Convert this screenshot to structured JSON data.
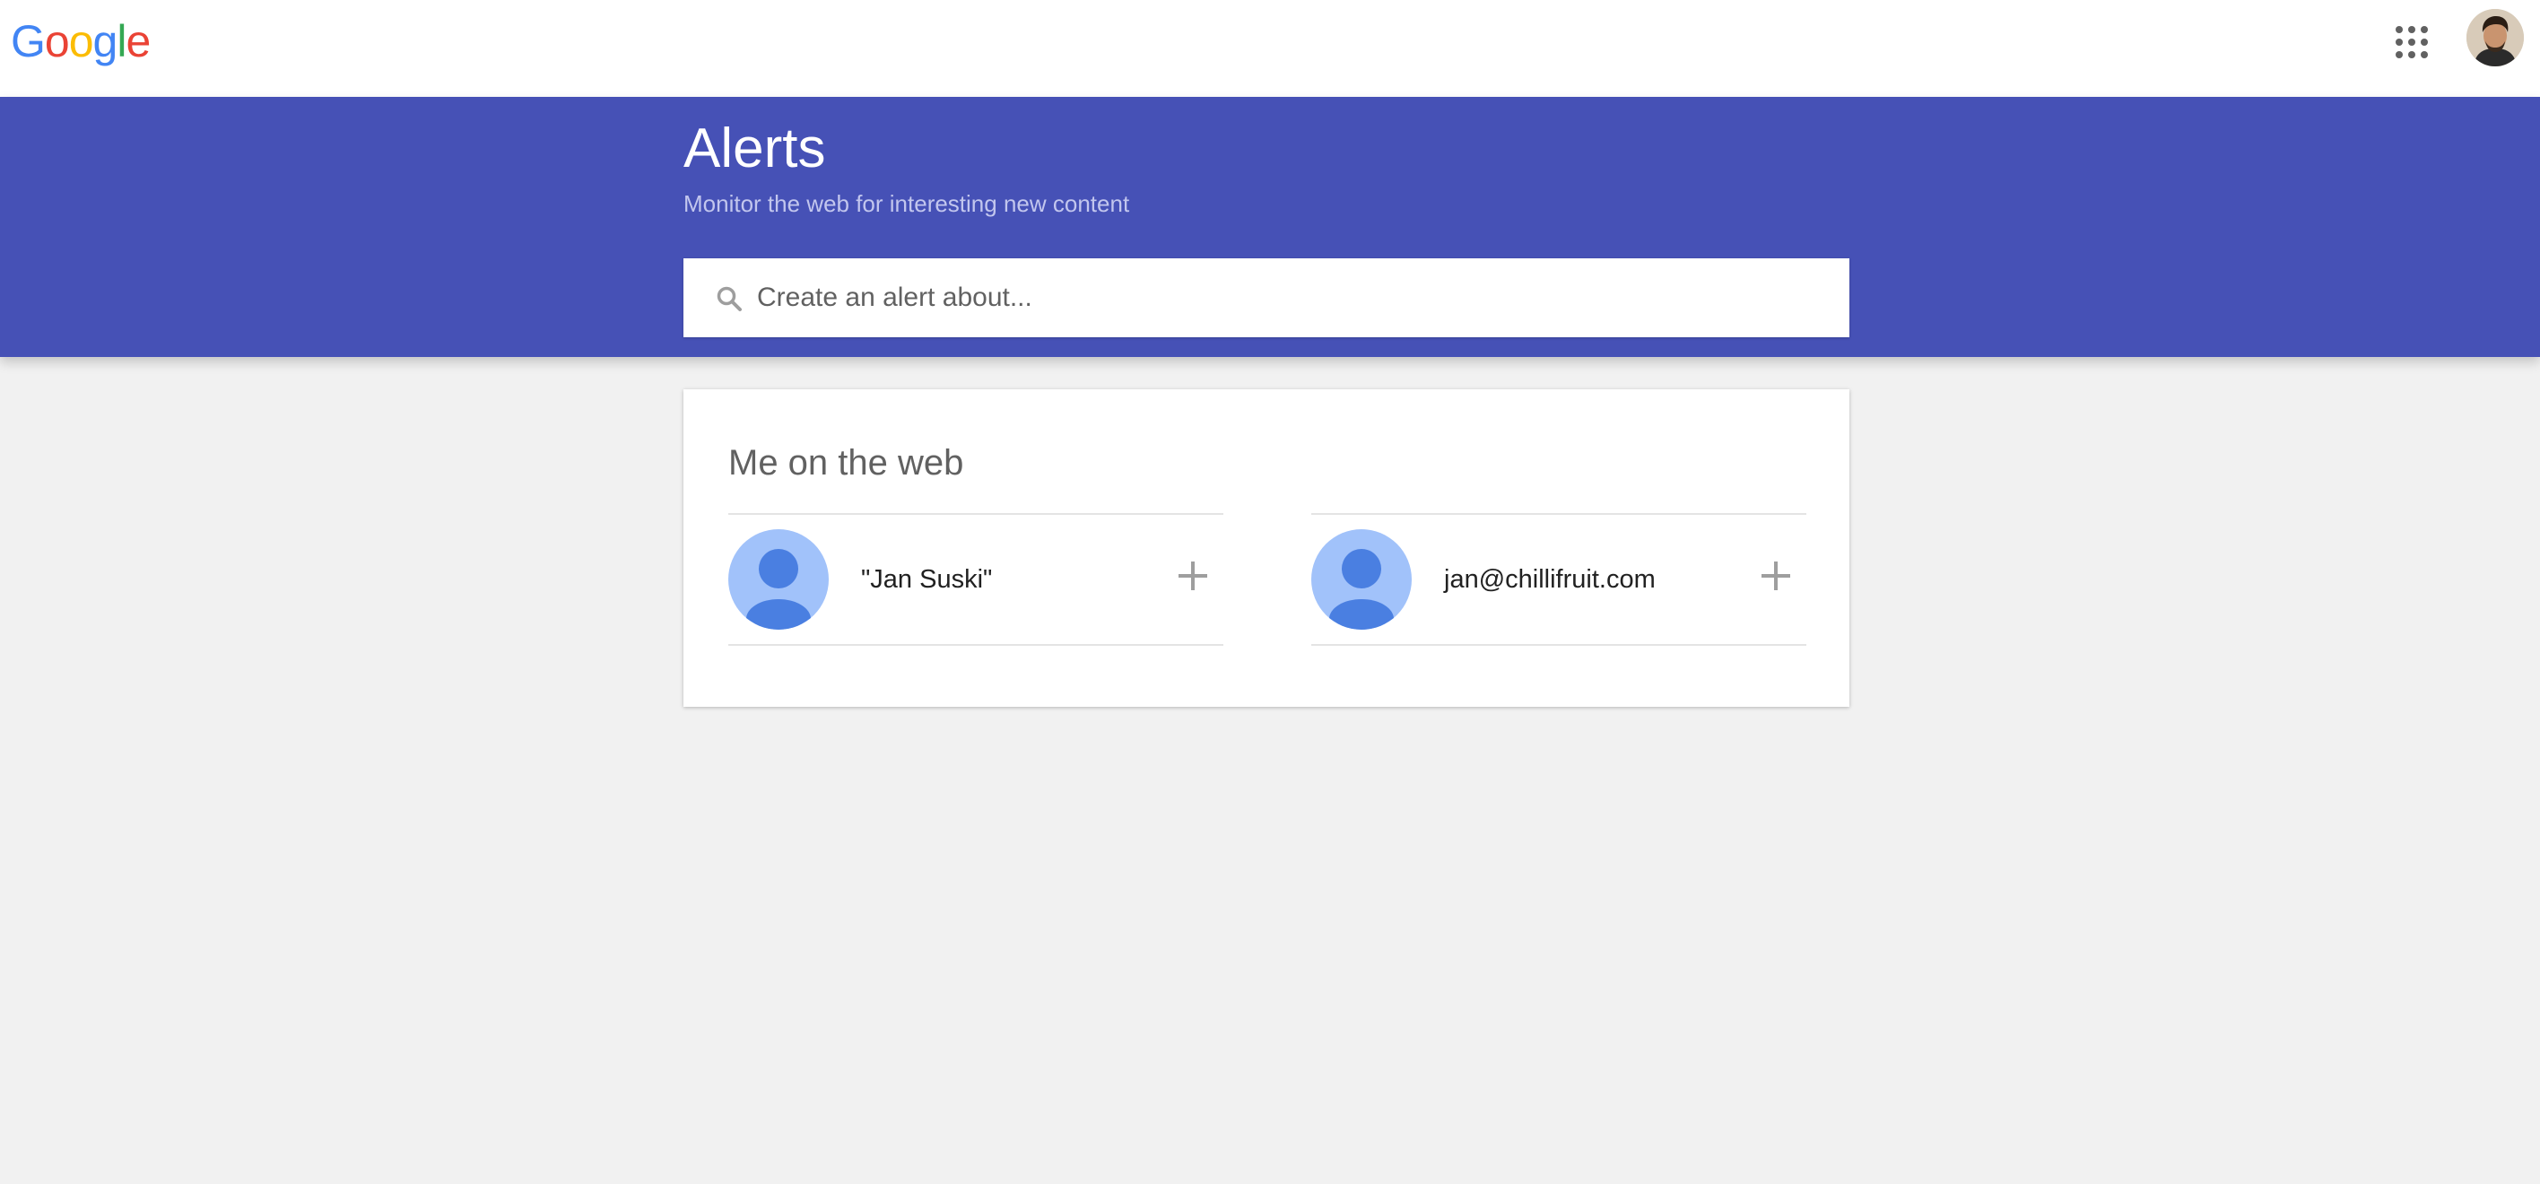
{
  "brand": {
    "logo_letters": [
      {
        "char": "G",
        "color": "#4285F4"
      },
      {
        "char": "o",
        "color": "#EA4335"
      },
      {
        "char": "o",
        "color": "#FBBC05"
      },
      {
        "char": "g",
        "color": "#4285F4"
      },
      {
        "char": "l",
        "color": "#34A853"
      },
      {
        "char": "e",
        "color": "#EA4335"
      }
    ]
  },
  "header": {
    "apps_icon": "apps-grid-icon",
    "account_icon": "account-avatar"
  },
  "page": {
    "title": "Alerts",
    "subtitle": "Monitor the web for interesting new content"
  },
  "search": {
    "placeholder": "Create an alert about...",
    "value": "",
    "icon": "search-icon"
  },
  "me_on_web": {
    "title": "Me on the web",
    "suggestions": [
      {
        "label": "\"Jan Suski\"",
        "icon": "person-icon",
        "action_icon": "plus-icon"
      },
      {
        "label": "jan@chillifruit.com",
        "icon": "person-icon",
        "action_icon": "plus-icon"
      }
    ]
  },
  "colors": {
    "header_band": "#4651B6",
    "page_background": "#F1F1F1",
    "avatar_background": "#A1C2FA",
    "avatar_figure": "#4A7FE1"
  }
}
